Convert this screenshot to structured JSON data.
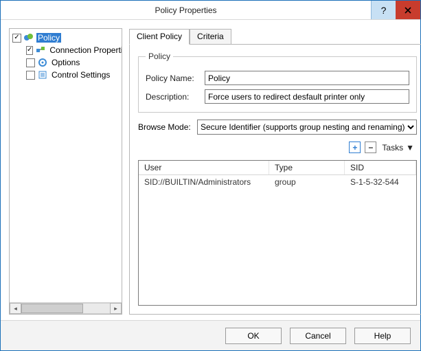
{
  "window": {
    "title": "Policy Properties"
  },
  "tree": {
    "root": {
      "label": "Policy",
      "checked": true
    },
    "children": [
      {
        "label": "Connection Properties",
        "checked": true
      },
      {
        "label": "Options",
        "checked": false
      },
      {
        "label": "Control Settings",
        "checked": false
      }
    ]
  },
  "tabs": {
    "client": "Client Policy",
    "criteria": "Criteria"
  },
  "policy": {
    "legend": "Policy",
    "name_label": "Policy Name:",
    "name_value": "Policy",
    "desc_label": "Description:",
    "desc_value": "Force users to redirect desfault printer only"
  },
  "browse": {
    "label": "Browse Mode:",
    "selected": "Secure Identifier (supports group nesting and renaming)"
  },
  "toolbar": {
    "tasks": "Tasks"
  },
  "grid": {
    "headers": {
      "user": "User",
      "type": "Type",
      "sid": "SID"
    },
    "rows": [
      {
        "user": "SID://BUILTIN/Administrators",
        "type": "group",
        "sid": "S-1-5-32-544"
      }
    ]
  },
  "buttons": {
    "ok": "OK",
    "cancel": "Cancel",
    "help": "Help"
  }
}
